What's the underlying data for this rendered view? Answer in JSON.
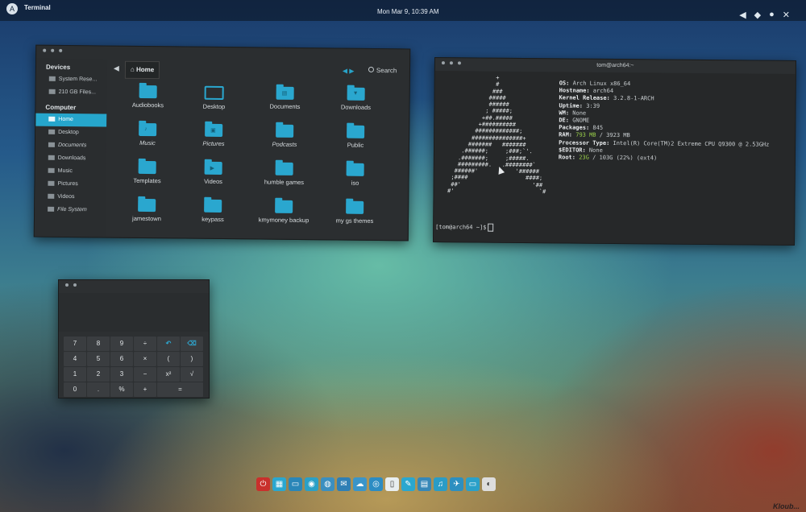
{
  "topbar": {
    "app_name": "Terminal",
    "clock": "Mon Mar  9, 10:39 AM",
    "tray_icons": [
      "volume-icon",
      "network-icon",
      "user-icon",
      "power-icon"
    ]
  },
  "files": {
    "sidebar": {
      "devices_header": "Devices",
      "devices": [
        "System Rese...",
        "210 GB Files..."
      ],
      "computer_header": "Computer",
      "places": [
        "Home",
        "Desktop",
        "Documents",
        "Downloads",
        "Music",
        "Pictures",
        "Videos",
        "File System"
      ],
      "selected": "Home"
    },
    "breadcrumb": "Home",
    "search_label": "Search",
    "items": [
      {
        "label": "Audiobooks",
        "glyph": ""
      },
      {
        "label": "Desktop",
        "glyph": ""
      },
      {
        "label": "Documents",
        "glyph": "▤"
      },
      {
        "label": "Downloads",
        "glyph": "▼"
      },
      {
        "label": "Music",
        "glyph": "♪"
      },
      {
        "label": "Pictures",
        "glyph": "▣"
      },
      {
        "label": "Podcasts",
        "glyph": ""
      },
      {
        "label": "Public",
        "glyph": ""
      },
      {
        "label": "Templates",
        "glyph": ""
      },
      {
        "label": "Videos",
        "glyph": "▶"
      },
      {
        "label": "humble games",
        "glyph": ""
      },
      {
        "label": "iso",
        "glyph": ""
      },
      {
        "label": "jamestown",
        "glyph": ""
      },
      {
        "label": "keypass",
        "glyph": ""
      },
      {
        "label": "kmymoney backup",
        "glyph": ""
      },
      {
        "label": "my gs themes",
        "glyph": ""
      }
    ]
  },
  "terminal": {
    "title": "tom@arch64:~",
    "info": {
      "os_key": "OS:",
      "os": "Arch Linux x86_64",
      "hostname_key": "Hostname:",
      "hostname": "arch64",
      "kernel_key": "Kernel Release:",
      "kernel": "3.2.8-1-ARCH",
      "uptime_key": "Uptime:",
      "uptime": "3:39",
      "wm_key": "WM:",
      "wm": "None",
      "de_key": "DE:",
      "de": "GNOME",
      "packages_key": "Packages:",
      "packages": "845",
      "ram_key": "RAM:",
      "ram_used": "793 MB",
      "ram_total": "/ 3923 MB",
      "cpu_key": "Processor Type:",
      "cpu": "Intel(R) Core(TM)2 Extreme CPU Q9300 @ 2.53GHz",
      "editor_key": "$EDITOR:",
      "editor": "None",
      "root_key": "Root:",
      "root_used": "23G",
      "root_rest": "/ 103G (22%) (ext4)"
    },
    "prompt": "[tom@arch64 ~]$"
  },
  "calculator": {
    "keys": [
      "7",
      "8",
      "9",
      "÷",
      "↶",
      "⌫",
      "4",
      "5",
      "6",
      "×",
      "(",
      ")",
      "1",
      "2",
      "3",
      "−",
      "x²",
      "√",
      "0",
      ".",
      "%",
      "+",
      "="
    ]
  },
  "dock": {
    "icons": [
      "power-icon",
      "window-icon",
      "display-icon",
      "browser-icon",
      "disk-icon",
      "mail-icon",
      "chat-icon",
      "globe-icon",
      "document-icon",
      "pen-icon",
      "calendar-icon",
      "headphones-icon",
      "plane-icon",
      "monitor-icon",
      "audio-icon"
    ]
  },
  "watermark": "Kloub..."
}
